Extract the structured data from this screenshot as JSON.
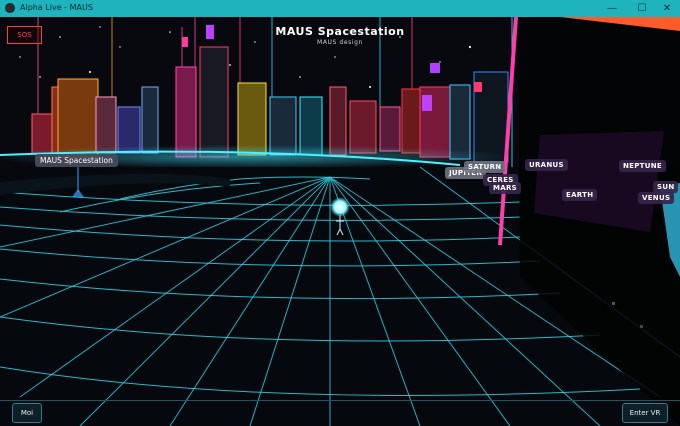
{
  "window": {
    "title": "Alpha Live - MAUS",
    "minimize": "—",
    "maximize": "☐",
    "close": "✕"
  },
  "header": {
    "title": "MAUS Spacestation",
    "subtitle": "MAUS design"
  },
  "sos_button": "SOS",
  "place_label": "MAUS Spacestation",
  "planets": {
    "saturn": "SATURN",
    "jupiter": "JUPITER",
    "ceres": "CERES",
    "mars": "MARS",
    "uranus": "URANUS",
    "neptune": "NEPTUNE",
    "earth": "EARTH",
    "venus": "VENUS",
    "sun": "SUN"
  },
  "bottom": {
    "left_button": "Moi",
    "right_button": "Enter VR"
  },
  "colors": {
    "titlebar": "#1fb3be",
    "grid": "#2fd8ee",
    "purple_panel": "#9a2ed6",
    "pink_beam": "#ff3fa8"
  }
}
